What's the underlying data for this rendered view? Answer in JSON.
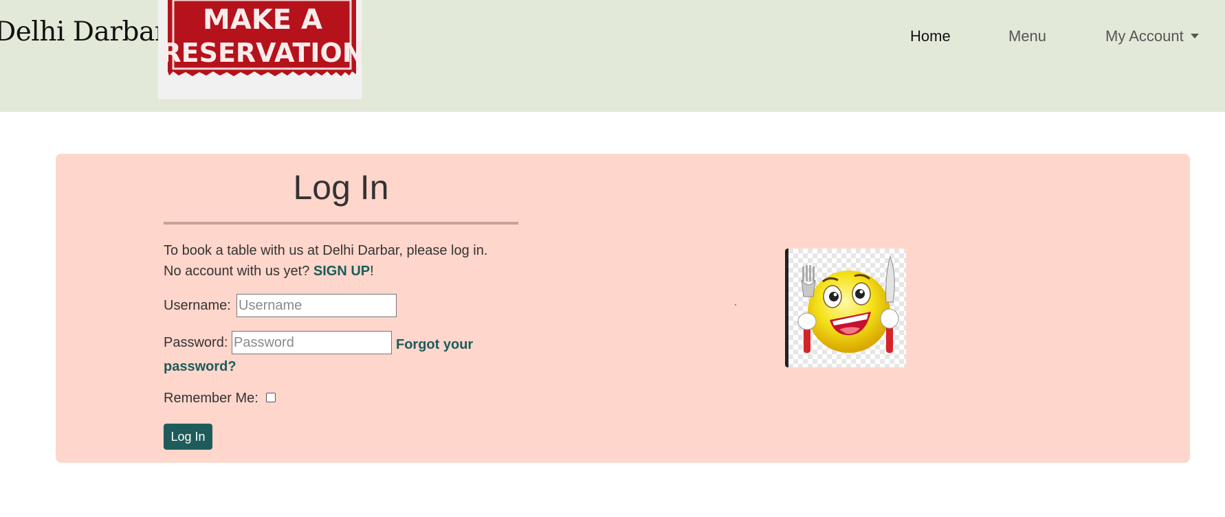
{
  "header": {
    "brand": "Delhi Darbar",
    "banner": {
      "line1": "MAKE A",
      "line2": "RESERVATION"
    },
    "nav": [
      {
        "label": "Home",
        "active": true
      },
      {
        "label": "Menu",
        "active": false
      },
      {
        "label": "My Account",
        "has_dropdown": true
      }
    ]
  },
  "login": {
    "title": "Log In",
    "intro_line1": "To book a table with us at Delhi Darbar, please log in.",
    "intro_line2_prefix": "No account with us yet? ",
    "signup_link": "SIGN UP",
    "intro_line2_suffix": "!",
    "username_label": "Username:",
    "username_placeholder": "Username",
    "username_value": "",
    "password_label": "Password:",
    "password_placeholder": "Password",
    "password_value": "",
    "forgot_link": "Forgot your password?",
    "remember_label": "Remember Me:",
    "remember_checked": false,
    "submit_label": "Log In"
  },
  "illustration": {
    "icon": "hungry-emoji-with-fork-and-knife-icon"
  },
  "colors": {
    "navbar_bg": "#e3e9d8",
    "card_bg": "#fed6cb",
    "accent": "#1e5c5b",
    "link": "#1a5c5a",
    "banner_red": "#b5121b"
  }
}
